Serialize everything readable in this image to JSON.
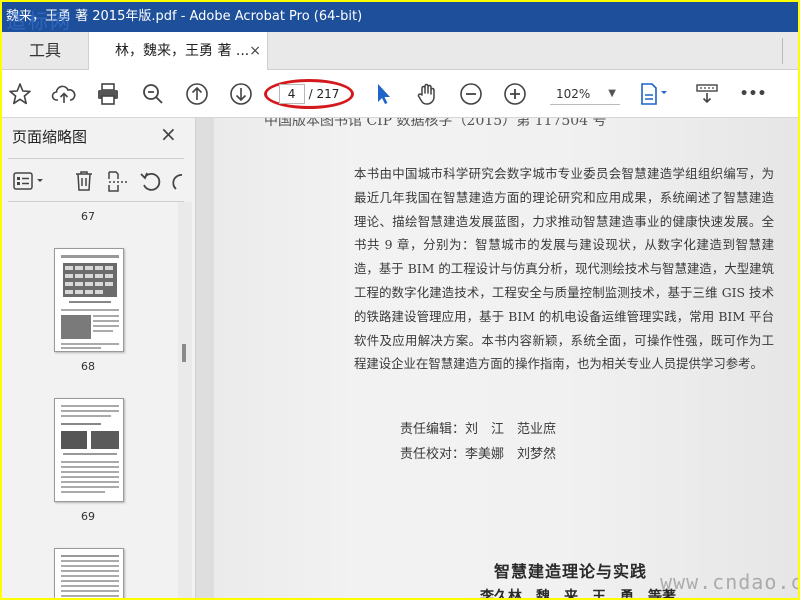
{
  "window": {
    "title": "魏来，王勇 著 2015年版.pdf - Adobe Acrobat Pro (64-bit)",
    "watermark_top": "造标网"
  },
  "tabs": {
    "tools_label": "工具",
    "doc_label": "林，魏来，王勇 著 ...",
    "doc_close": "×"
  },
  "toolbar": {
    "current_page": "4",
    "total_pages": "/ 217",
    "zoom": "102%",
    "more": "•••",
    "highlight_color": "#d4191d",
    "accent_color": "#1d4f9b"
  },
  "panel": {
    "title": "页面缩略图",
    "close": "×",
    "thumbnails": [
      {
        "page": "67"
      },
      {
        "page": "68"
      },
      {
        "page": "69"
      },
      {
        "page": ""
      }
    ]
  },
  "document": {
    "cip_line": "中国版本图书馆 CIP 数据核字（2015）第 117504 号",
    "body": "本书由中国城市科学研究会数字城市专业委员会智慧建造学组组织编写，为最近几年我国在智慧建造方面的理论研究和应用成果，系统阐述了智慧建造理论、描绘智慧建造发展蓝图，力求推动智慧建造事业的健康快速发展。全书共 9 章，分别为：智慧城市的发展与建设现状，从数字化建造到智慧建造，基于 BIM 的工程设计与仿真分析，现代测绘技术与智慧建造，大型建筑工程的数字化建造技术，工程安全与质量控制监测技术，基于三维 GIS 技术的铁路建设管理应用，基于 BIM 的机电设备运维管理实践，常用 BIM 平台软件及应用解决方案。本书内容新颖，系统全面，可操作性强，既可作为工程建设企业在智慧建造方面的操作指南，也为相关专业人员提供学习参考。",
    "editor": "责任编辑：刘　江　范业庶",
    "proofreader": "责任校对：李美娜　刘梦然",
    "book_title": "智慧建造理论与实践",
    "authors": "李久林　魏　来　王　勇　等著",
    "watermark_bottom": "www.cndao.com"
  }
}
